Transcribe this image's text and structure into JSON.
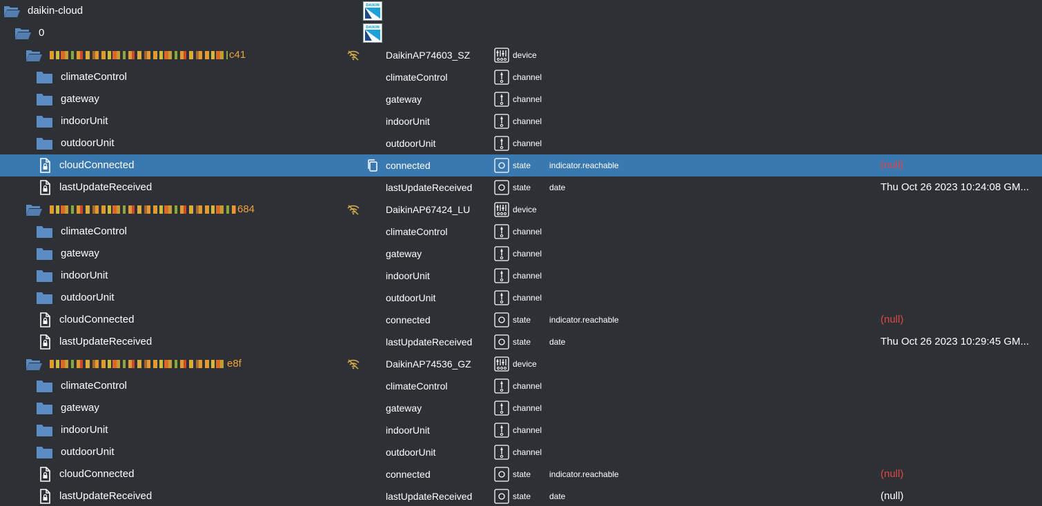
{
  "colors": {
    "background": "#2d3136",
    "selected": "#3a78b0",
    "folder": "#5b8cc4",
    "device_name": "#f2a03a",
    "null_value": "#e04545",
    "badge": "#d4a84a"
  },
  "rows": [
    {
      "kind": "root-folder",
      "name": "daikin-cloud",
      "logo": true,
      "indent": 0
    },
    {
      "kind": "root-folder",
      "name": "0",
      "logo": true,
      "indent": 1
    },
    {
      "kind": "device",
      "name": "c41",
      "masked": true,
      "badge": "wifi-off-icon",
      "title": "DaikinAP74603_SZ",
      "type": "device",
      "indent": 2
    },
    {
      "kind": "channel",
      "name": "climateControl",
      "title": "climateControl",
      "type": "channel",
      "indent": 3
    },
    {
      "kind": "channel",
      "name": "gateway",
      "title": "gateway",
      "type": "channel",
      "indent": 3
    },
    {
      "kind": "channel",
      "name": "indoorUnit",
      "title": "indoorUnit",
      "type": "channel",
      "indent": 3
    },
    {
      "kind": "channel",
      "name": "outdoorUnit",
      "title": "outdoorUnit",
      "type": "channel",
      "indent": 3
    },
    {
      "kind": "state",
      "name": "cloudConnected",
      "copy": true,
      "selected": true,
      "title": "connected",
      "type": "state",
      "role": "indicator.reachable",
      "value": "(null)",
      "value_style": "null",
      "indent": 3
    },
    {
      "kind": "state",
      "name": "lastUpdateReceived",
      "title": "lastUpdateReceived",
      "type": "state",
      "role": "date",
      "value": "Thu Oct 26 2023 10:24:08 GM...",
      "value_style": "plain",
      "indent": 3
    },
    {
      "kind": "device",
      "name": "684",
      "masked": true,
      "badge": "wifi-off-icon",
      "title": "DaikinAP67424_LU",
      "type": "device",
      "indent": 2
    },
    {
      "kind": "channel",
      "name": "climateControl",
      "title": "climateControl",
      "type": "channel",
      "indent": 3
    },
    {
      "kind": "channel",
      "name": "gateway",
      "title": "gateway",
      "type": "channel",
      "indent": 3
    },
    {
      "kind": "channel",
      "name": "indoorUnit",
      "title": "indoorUnit",
      "type": "channel",
      "indent": 3
    },
    {
      "kind": "channel",
      "name": "outdoorUnit",
      "title": "outdoorUnit",
      "type": "channel",
      "indent": 3
    },
    {
      "kind": "state",
      "name": "cloudConnected",
      "title": "connected",
      "type": "state",
      "role": "indicator.reachable",
      "value": "(null)",
      "value_style": "null",
      "indent": 3
    },
    {
      "kind": "state",
      "name": "lastUpdateReceived",
      "title": "lastUpdateReceived",
      "type": "state",
      "role": "date",
      "value": "Thu Oct 26 2023 10:29:45 GM...",
      "value_style": "plain",
      "indent": 3
    },
    {
      "kind": "device",
      "name": "e8f",
      "masked": true,
      "badge": "wifi-off-icon",
      "title": "DaikinAP74536_GZ",
      "type": "device",
      "indent": 2
    },
    {
      "kind": "channel",
      "name": "climateControl",
      "title": "climateControl",
      "type": "channel",
      "indent": 3
    },
    {
      "kind": "channel",
      "name": "gateway",
      "title": "gateway",
      "type": "channel",
      "indent": 3
    },
    {
      "kind": "channel",
      "name": "indoorUnit",
      "title": "indoorUnit",
      "type": "channel",
      "indent": 3
    },
    {
      "kind": "channel",
      "name": "outdoorUnit",
      "title": "outdoorUnit",
      "type": "channel",
      "indent": 3
    },
    {
      "kind": "state",
      "name": "cloudConnected",
      "title": "connected",
      "type": "state",
      "role": "indicator.reachable",
      "value": "(null)",
      "value_style": "null",
      "indent": 3
    },
    {
      "kind": "state",
      "name": "lastUpdateReceived",
      "title": "lastUpdateReceived",
      "type": "state",
      "role": "date",
      "value": "(null)",
      "value_style": "plain-null",
      "indent": 3
    }
  ]
}
